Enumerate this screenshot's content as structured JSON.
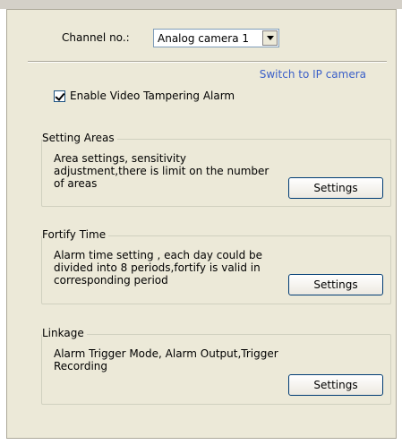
{
  "channel": {
    "label": "Channel no.:",
    "selected": "Analog camera 1"
  },
  "switch_link": "Switch to IP camera",
  "enable_alarm": {
    "label": "Enable Video Tampering Alarm",
    "checked": true
  },
  "groups": [
    {
      "title": "Setting Areas",
      "description": "Area settings, sensitivity adjustment,there is limit on the number of areas",
      "button": "Settings"
    },
    {
      "title": "Fortify Time",
      "description": "Alarm time setting , each day could be divided into 8 periods,fortify is valid in corresponding period",
      "button": "Settings"
    },
    {
      "title": "Linkage",
      "description": "Alarm Trigger Mode, Alarm Output,Trigger Recording",
      "button": "Settings"
    }
  ]
}
